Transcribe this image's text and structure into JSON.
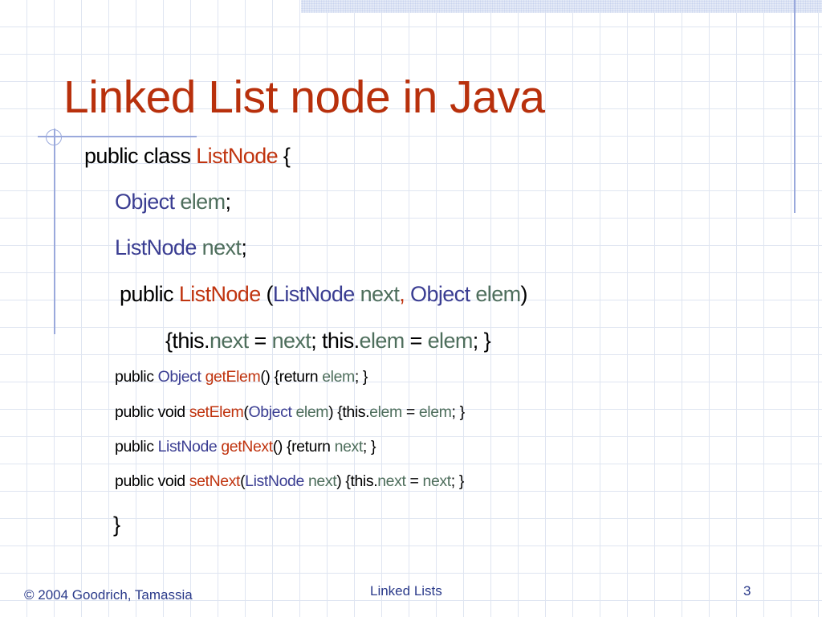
{
  "slide": {
    "title": "Linked List node in Java",
    "colors": {
      "title": "#b8300c",
      "keyword": "#c0340f",
      "type": "#3a3d92",
      "field": "#4e6e5c",
      "accent_lines": "#9aa9dc"
    },
    "code_lines": [
      {
        "size": "big",
        "tokens": [
          [
            "public class ",
            "black"
          ],
          [
            "ListNode",
            "red"
          ],
          [
            " {",
            "black"
          ]
        ]
      },
      {
        "size": "big",
        "tokens": [
          [
            "Object",
            "blue"
          ],
          [
            " elem",
            "green"
          ],
          [
            ";",
            "black"
          ]
        ]
      },
      {
        "size": "big",
        "tokens": [
          [
            "ListNode",
            "blue"
          ],
          [
            " next",
            "green"
          ],
          [
            ";",
            "black"
          ]
        ]
      },
      {
        "size": "big",
        "tokens": [
          [
            "public ",
            "black"
          ],
          [
            "ListNode",
            "red"
          ],
          [
            " (",
            "black"
          ],
          [
            "ListNode",
            "blue"
          ],
          [
            " next",
            "green"
          ],
          [
            ",",
            "red"
          ],
          [
            " Object",
            "blue"
          ],
          [
            " elem",
            "green"
          ],
          [
            ")",
            "black"
          ]
        ]
      },
      {
        "size": "big",
        "tokens": [
          [
            "{this.",
            "black"
          ],
          [
            "next",
            "green"
          ],
          [
            " = ",
            "black"
          ],
          [
            "next",
            "green"
          ],
          [
            "; this.",
            "black"
          ],
          [
            "elem",
            "green"
          ],
          [
            " = ",
            "black"
          ],
          [
            "elem",
            "green"
          ],
          [
            "; }",
            "black"
          ]
        ]
      },
      {
        "size": "small",
        "tokens": [
          [
            "public ",
            "black"
          ],
          [
            "Object",
            "blue"
          ],
          [
            " getElem",
            "red"
          ],
          [
            "() {return ",
            "black"
          ],
          [
            "elem",
            "green"
          ],
          [
            "; }",
            "black"
          ]
        ]
      },
      {
        "size": "small",
        "tokens": [
          [
            "public void ",
            "black"
          ],
          [
            "setElem",
            "red"
          ],
          [
            "(",
            "black"
          ],
          [
            "Object",
            "blue"
          ],
          [
            " elem",
            "green"
          ],
          [
            ") {this.",
            "black"
          ],
          [
            "elem",
            "green"
          ],
          [
            " = ",
            "black"
          ],
          [
            "elem",
            "green"
          ],
          [
            "; }",
            "black"
          ]
        ]
      },
      {
        "size": "small",
        "tokens": [
          [
            "public ",
            "black"
          ],
          [
            "ListNode",
            "blue"
          ],
          [
            " getNext",
            "red"
          ],
          [
            "() {return ",
            "black"
          ],
          [
            "next",
            "green"
          ],
          [
            "; }",
            "black"
          ]
        ]
      },
      {
        "size": "small",
        "tokens": [
          [
            "public void ",
            "black"
          ],
          [
            "setNext",
            "red"
          ],
          [
            "(",
            "black"
          ],
          [
            "ListNode",
            "blue"
          ],
          [
            " next",
            "green"
          ],
          [
            ") {this.",
            "black"
          ],
          [
            "next",
            "green"
          ],
          [
            " = ",
            "black"
          ],
          [
            "next",
            "green"
          ],
          [
            "; }",
            "black"
          ]
        ]
      },
      {
        "size": "big",
        "tokens": [
          [
            "}",
            "black"
          ]
        ]
      }
    ]
  },
  "footer": {
    "copyright": "© 2004 Goodrich, Tamassia",
    "topic": "Linked Lists",
    "page_number": "3"
  }
}
